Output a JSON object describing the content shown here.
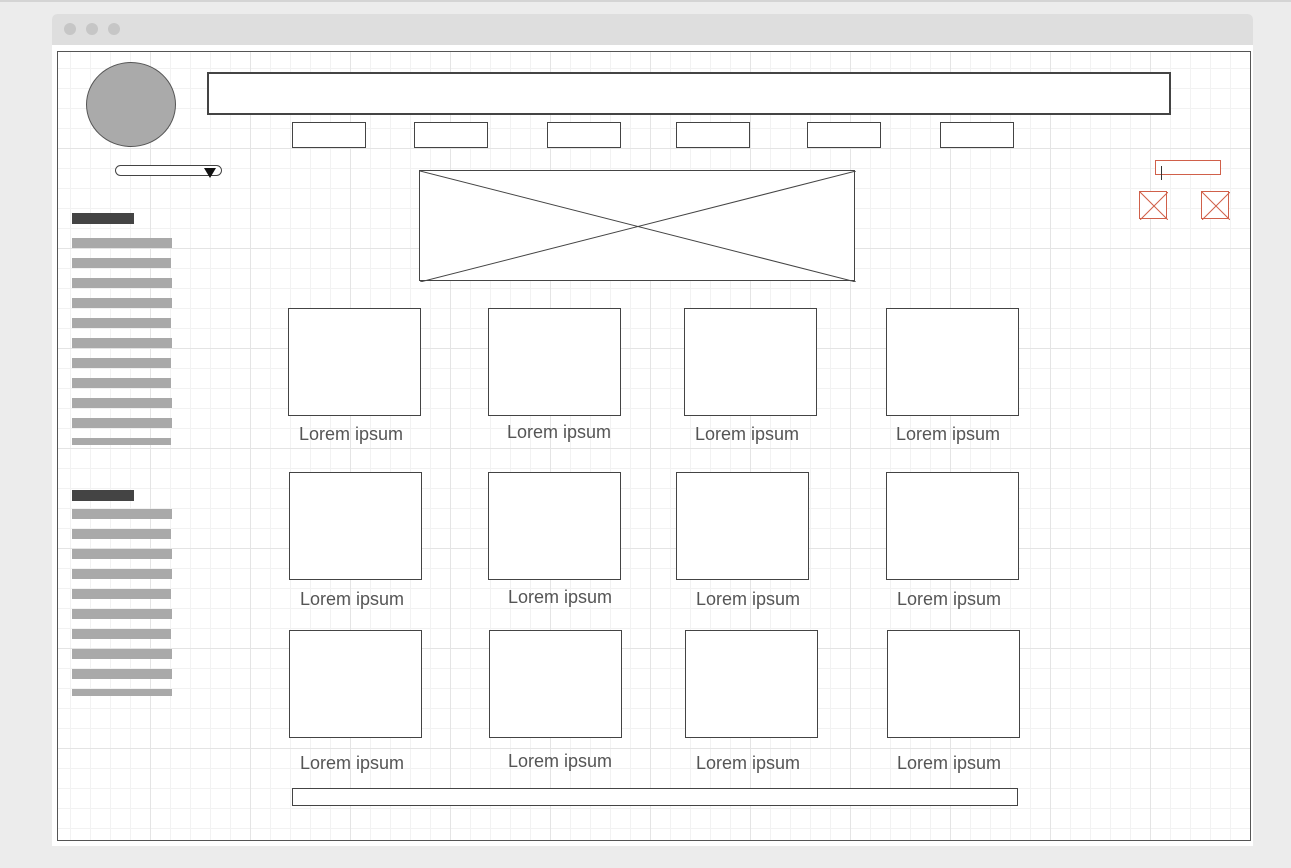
{
  "window": {
    "title_buttons": [
      "close",
      "minimize",
      "maximize"
    ]
  },
  "header": {
    "avatar_icon": "user-avatar-circle",
    "nav_items": [
      "",
      "",
      "",
      "",
      "",
      ""
    ]
  },
  "hero": {
    "icon": "image-placeholder-icon"
  },
  "login": {
    "social_icons": [
      "image-placeholder-icon",
      "image-placeholder-icon"
    ],
    "accent_color": "#d0604a"
  },
  "sidebar": {
    "groups": [
      {
        "line_count": 11
      },
      {
        "line_count": 10
      }
    ]
  },
  "grid": {
    "items": [
      {
        "caption": "Lorem ipsum"
      },
      {
        "caption": "Lorem ipsum"
      },
      {
        "caption": "Lorem ipsum"
      },
      {
        "caption": "Lorem ipsum"
      },
      {
        "caption": "Lorem ipsum"
      },
      {
        "caption": "Lorem ipsum"
      },
      {
        "caption": "Lorem ipsum"
      },
      {
        "caption": "Lorem ipsum"
      },
      {
        "caption": "Lorem ipsum"
      },
      {
        "caption": "Lorem ipsum"
      },
      {
        "caption": "Lorem ipsum"
      },
      {
        "caption": "Lorem ipsum"
      }
    ]
  },
  "colors": {
    "wireframe_stroke": "#444444",
    "placeholder_fill": "#aaaaaa",
    "sidebar_heading": "#444444",
    "sidebar_line": "#a9a9a9",
    "grid_line": "#e4e4e4"
  }
}
